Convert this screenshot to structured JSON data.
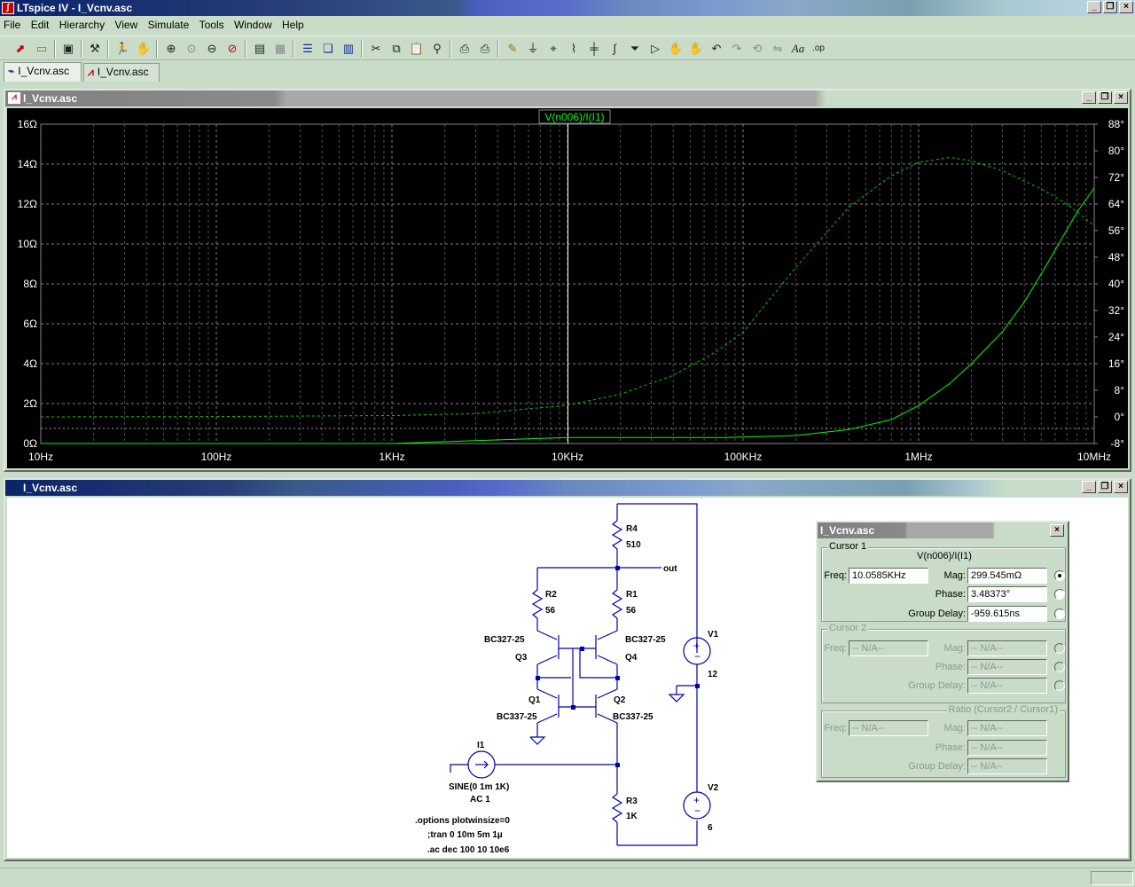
{
  "app": {
    "title": "LTspice IV - I_Vcnv.asc"
  },
  "menu": [
    "File",
    "Edit",
    "Hierarchy",
    "View",
    "Simulate",
    "Tools",
    "Window",
    "Help"
  ],
  "toolbar_icons": [
    "new-schematic-icon",
    "open-icon",
    "save-icon",
    "control-panel-icon",
    "run-icon",
    "halt-icon",
    "zoom-in-icon",
    "zoom-full-icon",
    "zoom-out-icon",
    "cancel-zoom-icon",
    "autorange-icon",
    "grid-icon",
    "tile-horizontal-icon",
    "cascade-icon",
    "tile-vertical-icon",
    "cut-icon",
    "copy-icon",
    "paste-icon",
    "find-icon",
    "print-setup-icon",
    "print-icon",
    "wire-icon",
    "ground-icon",
    "label-net-icon",
    "resistor-icon",
    "capacitor-icon",
    "inductor-icon",
    "diode-icon",
    "component-icon",
    "move-icon",
    "drag-icon",
    "undo-icon",
    "redo-icon",
    "rotate-icon",
    "mirror-icon",
    "text-icon",
    "spice-directive-icon"
  ],
  "tabs": [
    {
      "label": "I_Vcnv.asc",
      "kind": "schematic",
      "active": true
    },
    {
      "label": "I_Vcnv.asc",
      "kind": "waveform",
      "active": false
    }
  ],
  "plot_window": {
    "title": "I_Vcnv.asc"
  },
  "chart_data": {
    "type": "line",
    "trace_label": "V(n006)/I(I1)",
    "x_scale": "log",
    "xlim": [
      10,
      10000000
    ],
    "x_ticks": [
      "10Hz",
      "100Hz",
      "1KHz",
      "10KHz",
      "100KHz",
      "1MHz",
      "10MHz"
    ],
    "ylim_left": [
      0,
      16
    ],
    "y_ticks_left": [
      "16Ω",
      "14Ω",
      "12Ω",
      "10Ω",
      "8Ω",
      "6Ω",
      "4Ω",
      "2Ω",
      "0Ω"
    ],
    "ylim_right": [
      -8,
      88
    ],
    "y_ticks_right": [
      "88°",
      "80°",
      "72°",
      "64°",
      "56°",
      "48°",
      "40°",
      "32°",
      "24°",
      "16°",
      "8°",
      "0°",
      "-8°"
    ],
    "grid": true,
    "cursor_x": 10058.5,
    "series": [
      {
        "axis": "left",
        "style": "solid",
        "color": "#00ff00",
        "x": [
          10,
          1000,
          10000,
          80000,
          200000,
          400000,
          700000,
          1000000,
          1500000,
          2000000,
          3000000,
          4000000,
          5000000,
          6000000,
          8000000,
          10000000
        ],
        "y": [
          0.0,
          0.0,
          0.3,
          0.3,
          0.4,
          0.7,
          1.2,
          1.9,
          3.0,
          4.0,
          5.6,
          7.1,
          8.5,
          9.7,
          11.6,
          12.8
        ]
      },
      {
        "axis": "right",
        "style": "dashed",
        "color": "#00cc00",
        "x": [
          10,
          100,
          1000,
          3000,
          10000,
          20000,
          40000,
          70000,
          100000,
          200000,
          400000,
          700000,
          1000000,
          1500000,
          2000000,
          3000000,
          5000000,
          7000000,
          10000000
        ],
        "y": [
          0.0,
          0.1,
          0.4,
          1.0,
          3.5,
          6.8,
          12.5,
          19.5,
          25.5,
          45.0,
          63.0,
          72.5,
          76.5,
          78.0,
          77.0,
          74.0,
          68.5,
          64.0,
          57.5
        ]
      }
    ]
  },
  "schematic_window": {
    "title": "I_Vcnv.asc"
  },
  "schematic": {
    "R4": "R4",
    "R4_val": "510",
    "R2": "R2",
    "R2_val": "56",
    "R1": "R1",
    "R1_val": "56",
    "R3": "R3",
    "R3_val": "1K",
    "Q3": "Q3",
    "Q3_model": "BC327-25",
    "Q4": "Q4",
    "Q4_model": "BC327-25",
    "Q1": "Q1",
    "Q1_model": "BC337-25",
    "Q2": "Q2",
    "Q2_model": "BC337-25",
    "V1": "V1",
    "V1_val": "12",
    "V2": "V2",
    "V2_val": "6",
    "I1": "I1",
    "I1_val1": "SINE(0 1m 1K)",
    "I1_val2": "AC 1",
    "net_out": "out",
    "directive1": ".options plotwinsize=0",
    "directive2": ";tran 0 10m 5m 1µ",
    "directive3": ".ac dec 100 10 10e6"
  },
  "cursor_dialog": {
    "title": "I_Vcnv.asc",
    "cursor1": {
      "group": "Cursor 1",
      "trace": "V(n006)/I(I1)",
      "freq_label": "Freq:",
      "freq": "10.0585KHz",
      "mag_label": "Mag:",
      "mag": "299.545mΩ",
      "phase_label": "Phase:",
      "phase": "3.48373°",
      "gd_label": "Group Delay:",
      "gd": "-959.615ns"
    },
    "cursor2": {
      "group": "Cursor 2",
      "freq_label": "Freq:",
      "freq": "-- N/A--",
      "mag_label": "Mag:",
      "mag": "-- N/A--",
      "phase_label": "Phase:",
      "phase": "-- N/A--",
      "gd_label": "Group Delay:",
      "gd": "-- N/A--"
    },
    "ratio": {
      "group": "Ratio (Cursor2 / Cursor1)",
      "freq_label": "Freq:",
      "freq": "-- N/A--",
      "mag_label": "Mag:",
      "mag": "-- N/A--",
      "phase_label": "Phase:",
      "phase": "-- N/A--",
      "gd_label": "Group Delay:",
      "gd": "-- N/A--"
    }
  }
}
